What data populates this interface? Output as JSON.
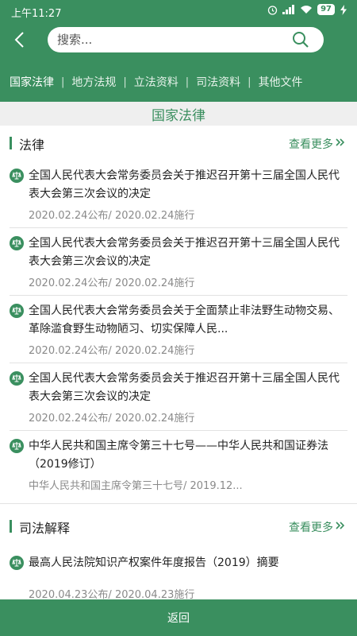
{
  "status": {
    "time": "上午11:27",
    "battery": "97"
  },
  "search": {
    "placeholder": "搜索..."
  },
  "tabs": [
    {
      "label": "国家法律"
    },
    {
      "label": "地方法规"
    },
    {
      "label": "立法资料"
    },
    {
      "label": "司法资料"
    },
    {
      "label": "其他文件"
    }
  ],
  "section_title": "国家法律",
  "categories": [
    {
      "label": "法律",
      "more": "查看更多",
      "items": [
        {
          "title": "全国人民代表大会常务委员会关于推迟召开第十三届全国人民代表大会第三次会议的决定",
          "meta": "2020.02.24公布/ 2020.02.24施行"
        },
        {
          "title": "全国人民代表大会常务委员会关于推迟召开第十三届全国人民代表大会第三次会议的决定",
          "meta": "2020.02.24公布/ 2020.02.24施行"
        },
        {
          "title": "全国人民代表大会常务委员会关于全面禁止非法野生动物交易、革除滥食野生动物陋习、切实保障人民...",
          "meta": "2020.02.24公布/ 2020.02.24施行"
        },
        {
          "title": "全国人民代表大会常务委员会关于推迟召开第十三届全国人民代表大会第三次会议的决定",
          "meta": "2020.02.24公布/ 2020.02.24施行"
        },
        {
          "title": "中华人民共和国主席令第三十七号——中华人民共和国证券法（2019修订）",
          "meta": "中华人民共和国主席令第三十七号/ 2019.12..."
        }
      ]
    },
    {
      "label": "司法解释",
      "more": "查看更多",
      "items": [
        {
          "title": "最高人民法院知识产权案件年度报告（2019）摘要",
          "meta": "2020.04.23公布/ 2020.04.23施行"
        }
      ]
    }
  ],
  "footer": {
    "back_label": "返回"
  },
  "colors": {
    "brand": "#3a8f5f",
    "section_bg": "#efefef"
  }
}
